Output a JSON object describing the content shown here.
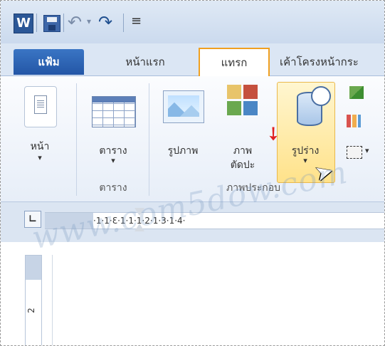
{
  "quick_access": {
    "word_icon": "W",
    "undo_glyph": "↶",
    "redo_glyph": "↷",
    "customize_glyph": "≡"
  },
  "tabs": {
    "file": "แฟ้ม",
    "home": "หน้าแรก",
    "insert": "แทรก",
    "page_layout": "เค้าโครงหน้ากระ"
  },
  "ribbon": {
    "page_button": "หน้า",
    "table_button": "ตาราง",
    "table_group": "ตาราง",
    "picture_button": "รูปภาพ",
    "clipart_button_line1": "ภาพ",
    "clipart_button_line2": "ตัดปะ",
    "shapes_button": "รูปร่าง",
    "illustrations_group": "ภาพประกอบ",
    "dropdown_glyph": "▾"
  },
  "ruler": {
    "horizontal_text": "·1·1·Ɛ·1·1·1·2·1·3·1·4·",
    "vertical_number": "2"
  },
  "watermark": "www.com5dow.com",
  "icons": [
    "word-icon",
    "save-icon",
    "undo-icon",
    "redo-icon",
    "page-icon",
    "table-icon",
    "picture-icon",
    "clipart-icon",
    "shapes-icon",
    "smartart-icon",
    "chart-icon",
    "screenshot-icon",
    "arrow-icon",
    "cursor-icon"
  ],
  "colors": {
    "file_tab": "#2356a6",
    "highlight_border": "#f0a020",
    "arrow": "#e02020"
  }
}
